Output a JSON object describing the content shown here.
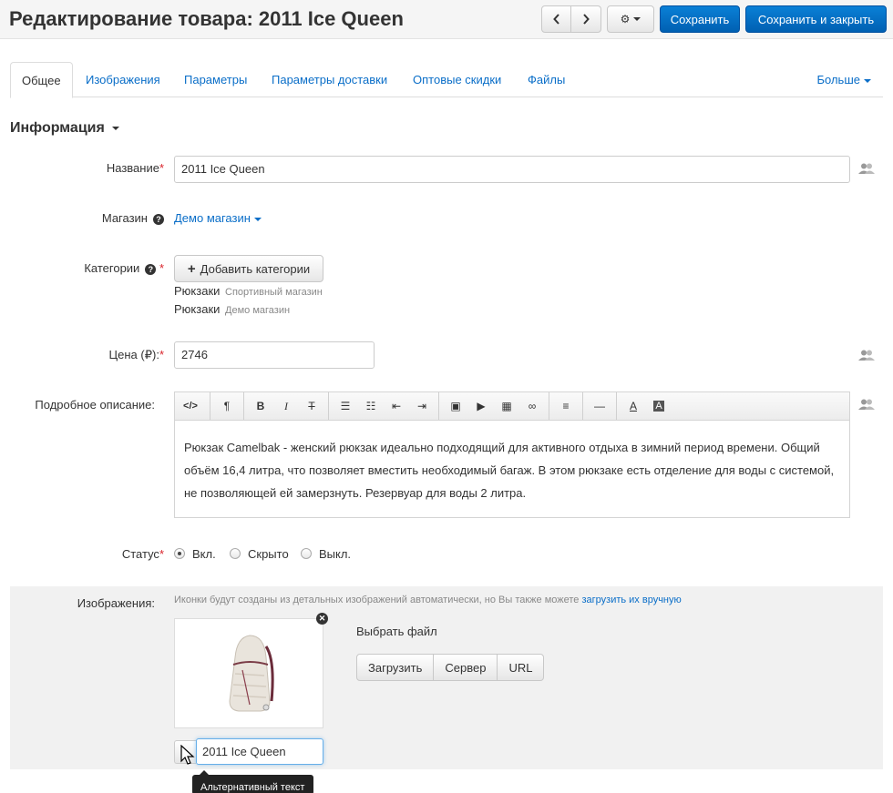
{
  "header": {
    "title": "Редактирование товара: 2011 Ice Queen",
    "save_label": "Сохранить",
    "save_close_label": "Сохранить и закрыть"
  },
  "tabs": {
    "items": [
      "Общее",
      "Изображения",
      "Параметры",
      "Параметры доставки",
      "Оптовые скидки",
      "Файлы"
    ],
    "active": "Общее",
    "more_label": "Больше"
  },
  "section": {
    "title": "Информация"
  },
  "form": {
    "name": {
      "label": "Название",
      "value": "2011 Ice Queen"
    },
    "store": {
      "label": "Магазин",
      "value": "Демо магазин"
    },
    "categories": {
      "label": "Категории",
      "add_label": "Добавить категории",
      "items": [
        {
          "name": "Рюкзаки",
          "store": "Спортивный магазин"
        },
        {
          "name": "Рюкзаки",
          "store": "Демо магазин"
        }
      ]
    },
    "price": {
      "label": "Цена (₽):",
      "value": "2746"
    },
    "description": {
      "label": "Подробное описание:",
      "text": "Рюкзак Camelbak - женский рюкзак идеально подходящий для активного отдыха в зимний период времени. Общий объём 16,4 литра, что позволяет вместить необходимый багаж. В этом рюкзаке есть отделение для воды с системой, не позволяющей ей замерзнуть. Резервуар для воды 2 литра."
    },
    "status": {
      "label": "Статус",
      "options": [
        "Вкл.",
        "Скрыто",
        "Выкл."
      ],
      "selected": "Вкл."
    },
    "images": {
      "label": "Изображения:",
      "hint": "Иконки будут созданы из детальных изображений автоматически, но Вы также можете",
      "hint_link": "загрузить их вручную",
      "choose_file": "Выбрать файл",
      "upload_buttons": [
        "Загрузить",
        "Сервер",
        "URL"
      ],
      "alt_value": "2011 Ice Queen",
      "alt_tooltip": "Альтернативный текст"
    }
  },
  "colors": {
    "primary": "#0a6ec8",
    "required": "#d9252c"
  }
}
